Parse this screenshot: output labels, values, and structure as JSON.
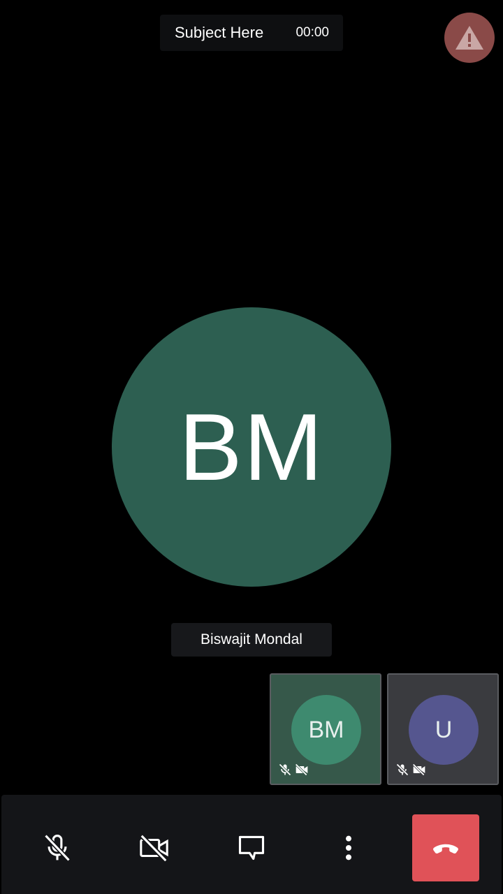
{
  "header": {
    "subject": "Subject Here",
    "timer": "00:00"
  },
  "main_participant": {
    "initials": "BM",
    "name": "Biswajit Mondal"
  },
  "thumbnails": [
    {
      "initials": "BM"
    },
    {
      "initials": "U"
    }
  ],
  "colors": {
    "background": "#000000",
    "main_avatar": "#2d5f51",
    "thumb1_avatar": "#3e8a6f",
    "thumb2_avatar": "#55568f",
    "hangup": "#e05258",
    "warning": "#8a4a48"
  },
  "toolbar": {
    "icons": [
      "mic-off-icon",
      "video-off-icon",
      "chat-icon",
      "more-vertical-icon",
      "hangup-icon"
    ]
  }
}
